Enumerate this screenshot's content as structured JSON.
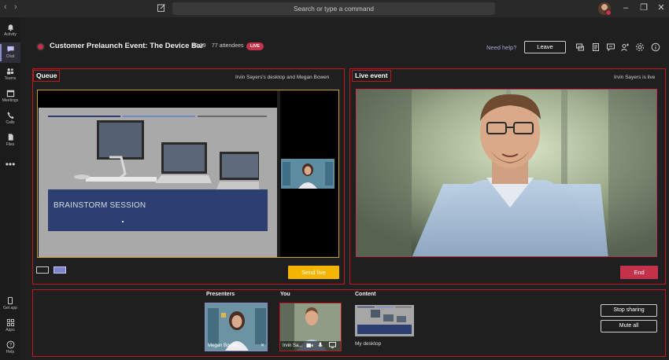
{
  "titlebar": {
    "back_icon": "chevron-left-icon",
    "forward_icon": "chevron-right-icon",
    "compose_icon": "compose-icon",
    "search_placeholder": "Search or type a command",
    "window_controls": [
      "minimize-icon",
      "restore-icon",
      "close-icon"
    ]
  },
  "rail": {
    "items": [
      {
        "label": "Activity",
        "icon": "bell-icon"
      },
      {
        "label": "Chat",
        "icon": "chat-icon"
      },
      {
        "label": "Teams",
        "icon": "teams-icon"
      },
      {
        "label": "Meetings",
        "icon": "calendar-icon"
      },
      {
        "label": "Calls",
        "icon": "phone-icon"
      },
      {
        "label": "Files",
        "icon": "file-icon"
      },
      {
        "label": "",
        "icon": "more-icon"
      }
    ],
    "bottom_items": [
      {
        "label": "Get app",
        "icon": "device-icon"
      },
      {
        "label": "Apps",
        "icon": "apps-icon"
      },
      {
        "label": "Help",
        "icon": "help-icon"
      }
    ],
    "active_index": 1
  },
  "meeting": {
    "title": "Customer Prelaunch Event: The Device Bar",
    "elapsed": "43:39",
    "attendees": "77 attendees",
    "live_badge": "LIVE",
    "help_link": "Need help?",
    "leave_label": "Leave",
    "header_icons": [
      "chat-bubble-icon",
      "notes-icon",
      "qa-icon",
      "add-people-icon",
      "settings-icon",
      "info-icon"
    ]
  },
  "queue": {
    "label": "Queue",
    "subtitle": "Irvin Sayers's desktop and Megan Bowen",
    "slide_title": "BRAINSTORM SESSION",
    "send_live_label": "Send live"
  },
  "live_event": {
    "label": "Live event",
    "subtitle": "Irvin Sayers is live",
    "end_label": "End"
  },
  "bottom": {
    "presenters_header": "Presenters",
    "you_header": "You",
    "content_header": "Content",
    "presenter_name": "Megan Bowen",
    "you_name": "Irvin Sa...",
    "content_name": "My desktop",
    "stop_sharing_label": "Stop sharing",
    "mute_all_label": "Mute all"
  },
  "colors": {
    "accent_live": "#c4314b",
    "send_live": "#f5b400",
    "highlight_box": "#c4161c",
    "brand": "#8b8cc7"
  }
}
